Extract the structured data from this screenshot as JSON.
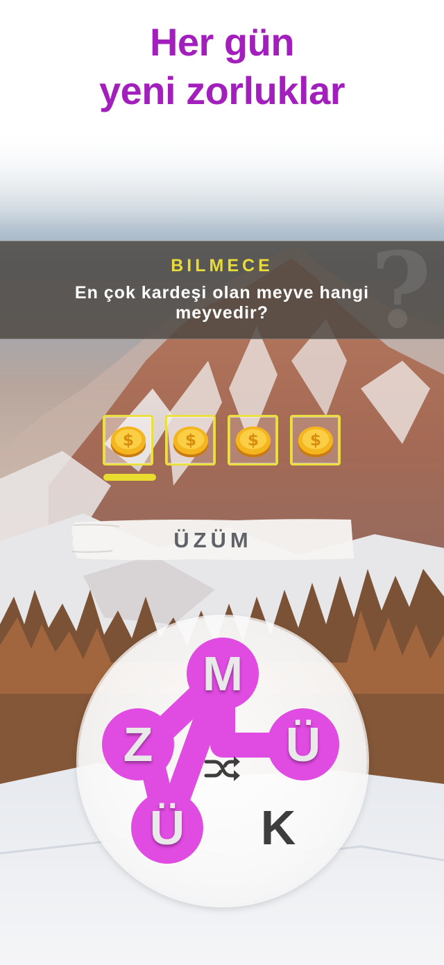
{
  "headline": {
    "line1": "Her gün",
    "line2": "yeni zorluklar"
  },
  "riddle": {
    "title": "BILMECE",
    "question": "En çok kardeşi olan meyve hangi meyvedir?",
    "watermark_icon": "question-mark-icon"
  },
  "answer_slots": {
    "count": 4,
    "icon": "coin-icon",
    "active_index": 0
  },
  "current_word": "ÜZÜM",
  "wheel": {
    "letters": [
      {
        "char": "M",
        "selected": true
      },
      {
        "char": "Z",
        "selected": true
      },
      {
        "char": "Ü",
        "selected": true
      },
      {
        "char": "Ü",
        "selected": true
      },
      {
        "char": "K",
        "selected": false
      }
    ],
    "shuffle_icon": "shuffle-icon"
  },
  "colors": {
    "headline": "#a31fbd",
    "riddle_title": "#e9dc3a",
    "slot_border": "#eadf3f",
    "letter_selected": "#e04be1",
    "connector": "#e04be1"
  }
}
